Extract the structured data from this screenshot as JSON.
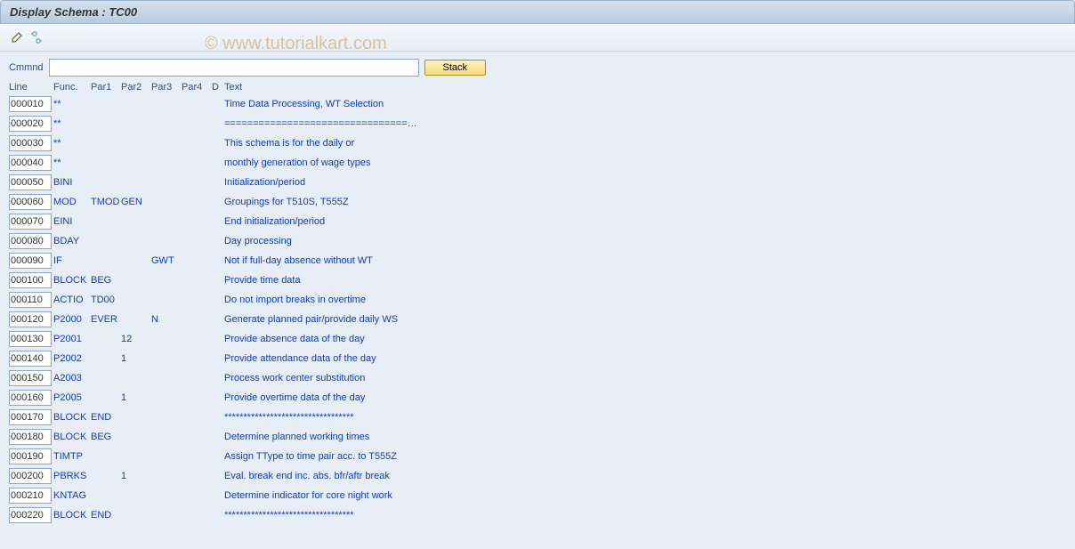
{
  "title": "Display Schema : TC00",
  "watermark": "© www.tutorialkart.com",
  "command": {
    "label": "Cmmnd",
    "value": "",
    "stack_label": "Stack"
  },
  "headers": {
    "line": "Line",
    "func": "Func.",
    "par1": "Par1",
    "par2": "Par2",
    "par3": "Par3",
    "par4": "Par4",
    "d": "D",
    "text": "Text"
  },
  "rows": [
    {
      "line": "000010",
      "func": "**",
      "par1": "",
      "par2": "",
      "par3": "",
      "par4": "",
      "d": "",
      "text": "Time Data Processing, WT Selection"
    },
    {
      "line": "000020",
      "func": "**",
      "par1": "",
      "par2": "",
      "par3": "",
      "par4": "",
      "d": "",
      "text": "================================…"
    },
    {
      "line": "000030",
      "func": "**",
      "par1": "",
      "par2": "",
      "par3": "",
      "par4": "",
      "d": "",
      "text": "This schema is for the daily or"
    },
    {
      "line": "000040",
      "func": "**",
      "par1": "",
      "par2": "",
      "par3": "",
      "par4": "",
      "d": "",
      "text": "monthly generation of wage types"
    },
    {
      "line": "000050",
      "func": "BINI",
      "par1": "",
      "par2": "",
      "par3": "",
      "par4": "",
      "d": "",
      "text": "Initialization/period"
    },
    {
      "line": "000060",
      "func": "MOD",
      "par1": "TMOD",
      "par2": "GEN",
      "par3": "",
      "par4": "",
      "d": "",
      "text": "Groupings for T510S, T555Z"
    },
    {
      "line": "000070",
      "func": "EINI",
      "par1": "",
      "par2": "",
      "par3": "",
      "par4": "",
      "d": "",
      "text": "End initialization/period"
    },
    {
      "line": "000080",
      "func": "BDAY",
      "par1": "",
      "par2": "",
      "par3": "",
      "par4": "",
      "d": "",
      "text": "Day processing"
    },
    {
      "line": "000090",
      "func": "IF",
      "par1": "",
      "par2": "",
      "par3": "GWT",
      "par4": "",
      "d": "",
      "text": "Not if full-day absence without WT"
    },
    {
      "line": "000100",
      "func": "BLOCK",
      "par1": "BEG",
      "par2": "",
      "par3": "",
      "par4": "",
      "d": "",
      "text": "Provide time data"
    },
    {
      "line": "000110",
      "func": "ACTIO",
      "par1": "TD00",
      "par2": "",
      "par3": "",
      "par4": "",
      "d": "",
      "text": "Do not import breaks in overtime"
    },
    {
      "line": "000120",
      "func": "P2000",
      "par1": "EVER",
      "par2": "",
      "par3": "N",
      "par4": "",
      "d": "",
      "text": "Generate planned pair/provide daily WS"
    },
    {
      "line": "000130",
      "func": "P2001",
      "par1": "",
      "par2": "12",
      "par3": "",
      "par4": "",
      "d": "",
      "text": "Provide absence data of the day"
    },
    {
      "line": "000140",
      "func": "P2002",
      "par1": "",
      "par2": "1",
      "par3": "",
      "par4": "",
      "d": "",
      "text": "Provide attendance data of the day"
    },
    {
      "line": "000150",
      "func": "A2003",
      "par1": "",
      "par2": "",
      "par3": "",
      "par4": "",
      "d": "",
      "text": "Process work center substitution"
    },
    {
      "line": "000160",
      "func": "P2005",
      "par1": "",
      "par2": "1",
      "par3": "",
      "par4": "",
      "d": "",
      "text": "Provide overtime data of the day"
    },
    {
      "line": "000170",
      "func": "BLOCK",
      "par1": "END",
      "par2": "",
      "par3": "",
      "par4": "",
      "d": "",
      "text": "**********************************"
    },
    {
      "line": "000180",
      "func": "BLOCK",
      "par1": "BEG",
      "par2": "",
      "par3": "",
      "par4": "",
      "d": "",
      "text": "Determine planned working times"
    },
    {
      "line": "000190",
      "func": "TIMTP",
      "par1": "",
      "par2": "",
      "par3": "",
      "par4": "",
      "d": "",
      "text": "Assign TType to time pair acc. to T555Z"
    },
    {
      "line": "000200",
      "func": "PBRKS",
      "par1": "",
      "par2": "1",
      "par3": "",
      "par4": "",
      "d": "",
      "text": "Eval. break end inc. abs. bfr/aftr break"
    },
    {
      "line": "000210",
      "func": "KNTAG",
      "par1": "",
      "par2": "",
      "par3": "",
      "par4": "",
      "d": "",
      "text": "Determine indicator for core night work"
    },
    {
      "line": "000220",
      "func": "BLOCK",
      "par1": "END",
      "par2": "",
      "par3": "",
      "par4": "",
      "d": "",
      "text": "**********************************"
    }
  ]
}
